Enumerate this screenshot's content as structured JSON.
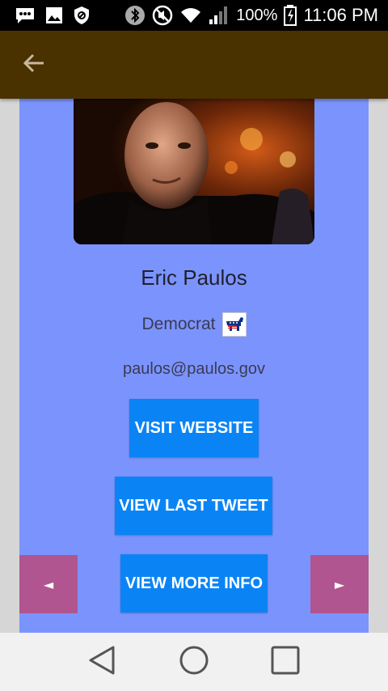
{
  "status_bar": {
    "battery_percent": "100%",
    "time": "11:06 PM",
    "icons": [
      "bbm-icon",
      "image-icon",
      "shield-icon",
      "bluetooth-icon",
      "mute-icon",
      "wifi-icon",
      "signal-icon",
      "battery-charging-icon"
    ]
  },
  "app_bar": {
    "back_icon": "arrow-back-icon",
    "background": "#4a3100"
  },
  "profile": {
    "name": "Eric Paulos",
    "party": "Democrat",
    "party_icon": "democrat-donkey-icon",
    "email": "paulos@paulos.gov"
  },
  "buttons": {
    "visit_website": "VISIT WEBSITE",
    "view_last_tweet": "VIEW LAST TWEET",
    "view_more_info": "VIEW MORE INFO",
    "prev": "◄",
    "next": "►"
  },
  "nav_bar": {
    "back": "back-triangle-icon",
    "home": "home-circle-icon",
    "recents": "recents-square-icon"
  },
  "colors": {
    "content_bg": "#7b94fd",
    "button_bg": "#0a84f5",
    "arrow_bg": "#b05590"
  }
}
